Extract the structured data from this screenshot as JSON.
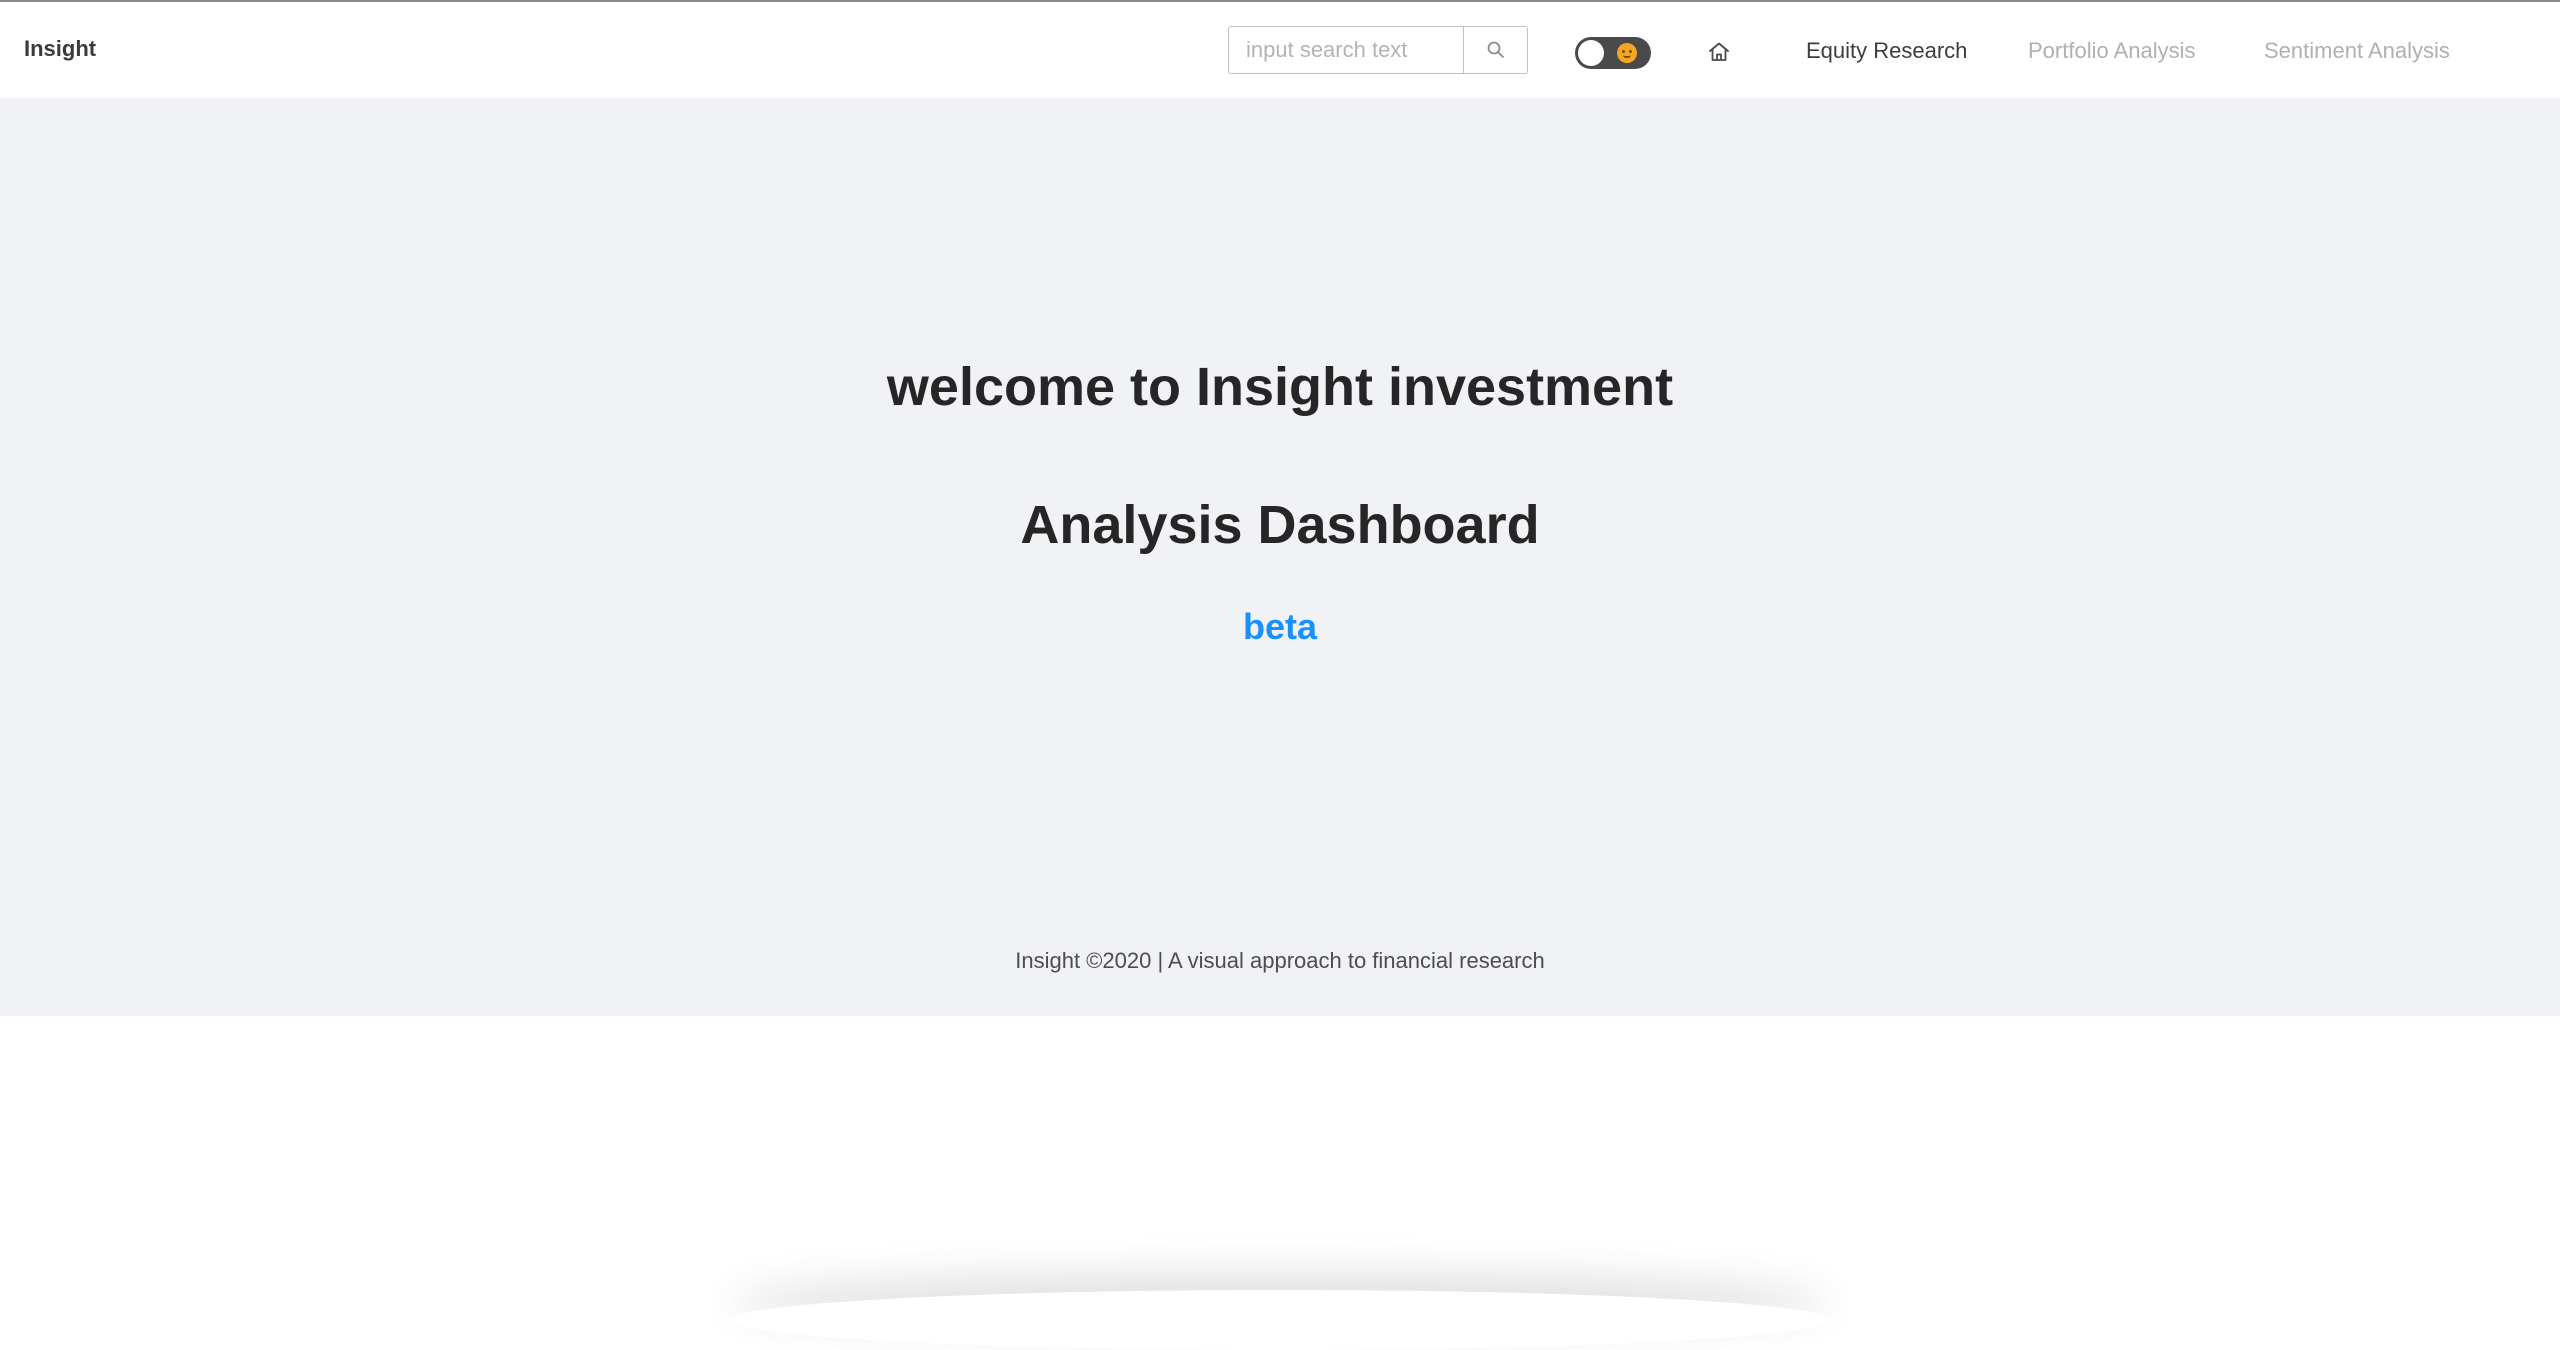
{
  "header": {
    "brand": "Insight",
    "search": {
      "placeholder": "input search text",
      "value": ""
    },
    "icons": {
      "search": "search-icon",
      "theme": "theme-toggle",
      "home": "home-icon"
    },
    "nav": [
      {
        "label": "Equity Research",
        "state": "active"
      },
      {
        "label": "Portfolio Analysis",
        "state": "disabled"
      },
      {
        "label": "Sentiment Analysis",
        "state": "disabled"
      }
    ]
  },
  "hero": {
    "line1": "welcome to Insight investment",
    "line2": "Analysis Dashboard",
    "tag": "beta"
  },
  "footer": {
    "text": "Insight ©2020 | A visual approach to financial research"
  },
  "colors": {
    "accent": "#1890ff",
    "background": "#f0f2f5",
    "nav_active": "#3d3d3d",
    "nav_disabled": "#b0b0b0",
    "toggle_track": "#4a4a4a"
  }
}
